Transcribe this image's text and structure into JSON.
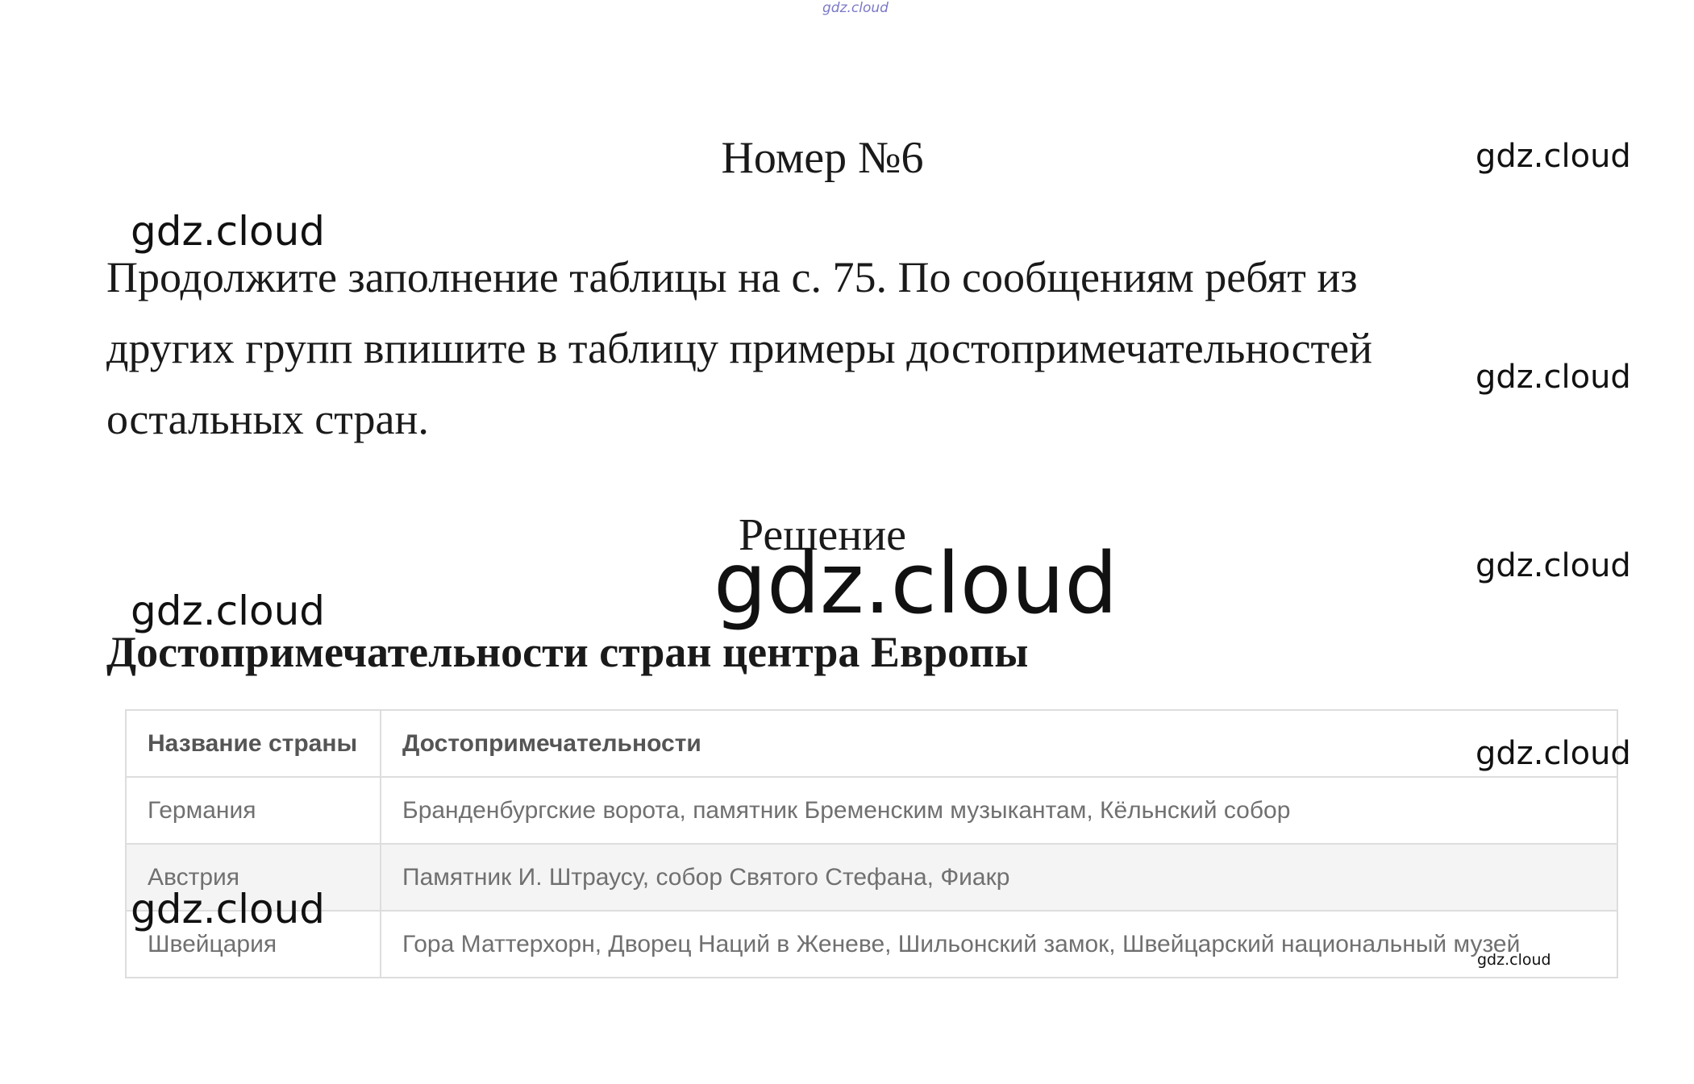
{
  "watermarks": {
    "top": "gdz.cloud",
    "right_1": "gdz.cloud",
    "right_2": "gdz.cloud",
    "right_3": "gdz.cloud",
    "right_4": "gdz.cloud",
    "left_1": "gdz.cloud",
    "left_2": "gdz.cloud",
    "left_3": "gdz.cloud",
    "center_big": "gdz.cloud",
    "table_small": "gdz.cloud"
  },
  "page": {
    "title": "Номер №6",
    "task_lines": [
      "Продолжите заполнение таблицы на с. 75. По сообщениям ребят из",
      "других групп впишите в таблицу примеры достопримечательностей",
      "остальных стран."
    ],
    "solution_heading": "Решение",
    "table_title": "Достопримечательности стран центра Европы"
  },
  "table": {
    "headers": [
      "Название страны",
      "Достопримечательности"
    ],
    "rows": [
      [
        "Германия",
        "Бранденбургские ворота, памятник Бременским музыкантам, Кёльнский собор"
      ],
      [
        "Австрия",
        "Памятник И. Штраусу, собор Святого Стефана, Фиакр"
      ],
      [
        "Швейцария",
        "Гора Маттерхорн, Дворец Наций в Женеве, Шильонский замок, Швейцарский национальный музей"
      ]
    ]
  }
}
